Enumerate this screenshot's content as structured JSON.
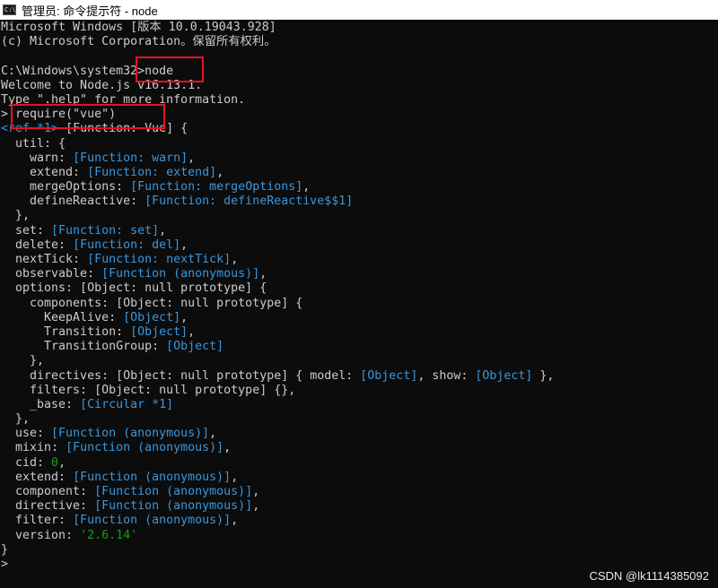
{
  "window": {
    "title": "管理员: 命令提示符 - node",
    "icon": "cmd-icon"
  },
  "console": {
    "lines": [
      [
        {
          "t": "Microsoft Windows [版本 10.0.19043.928]"
        }
      ],
      [
        {
          "t": "(c) Microsoft Corporation。保留所有权利。"
        }
      ],
      [
        {
          "t": ""
        }
      ],
      [
        {
          "t": "C:\\Windows\\system32>node"
        }
      ],
      [
        {
          "t": "Welcome to Node.js v16.13.1."
        }
      ],
      [
        {
          "t": "Type \".help\" for more information."
        }
      ],
      [
        {
          "t": "> require(\"vue\")"
        }
      ],
      [
        {
          "t": "<ref *1> ",
          "c": "fn"
        },
        {
          "t": "[Function: Vue] {"
        }
      ],
      [
        {
          "t": "  util: {"
        }
      ],
      [
        {
          "t": "    warn: "
        },
        {
          "t": "[Function: warn]",
          "c": "fn"
        },
        {
          "t": ","
        }
      ],
      [
        {
          "t": "    extend: "
        },
        {
          "t": "[Function: extend]",
          "c": "fn"
        },
        {
          "t": ","
        }
      ],
      [
        {
          "t": "    mergeOptions: "
        },
        {
          "t": "[Function: mergeOptions]",
          "c": "fn"
        },
        {
          "t": ","
        }
      ],
      [
        {
          "t": "    defineReactive: "
        },
        {
          "t": "[Function: defineReactive$$1]",
          "c": "fn"
        }
      ],
      [
        {
          "t": "  },"
        }
      ],
      [
        {
          "t": "  set: "
        },
        {
          "t": "[Function: set]",
          "c": "fn"
        },
        {
          "t": ","
        }
      ],
      [
        {
          "t": "  delete: "
        },
        {
          "t": "[Function: del]",
          "c": "fn"
        },
        {
          "t": ","
        }
      ],
      [
        {
          "t": "  nextTick: "
        },
        {
          "t": "[Function: nextTick]",
          "c": "fn"
        },
        {
          "t": ","
        }
      ],
      [
        {
          "t": "  observable: "
        },
        {
          "t": "[Function (anonymous)]",
          "c": "fn"
        },
        {
          "t": ","
        }
      ],
      [
        {
          "t": "  options: [Object: null prototype] {"
        }
      ],
      [
        {
          "t": "    components: [Object: null prototype] {"
        }
      ],
      [
        {
          "t": "      KeepAlive: "
        },
        {
          "t": "[Object]",
          "c": "fn"
        },
        {
          "t": ","
        }
      ],
      [
        {
          "t": "      Transition: "
        },
        {
          "t": "[Object]",
          "c": "fn"
        },
        {
          "t": ","
        }
      ],
      [
        {
          "t": "      TransitionGroup: "
        },
        {
          "t": "[Object]",
          "c": "fn"
        }
      ],
      [
        {
          "t": "    },"
        }
      ],
      [
        {
          "t": "    directives: [Object: null prototype] { model: "
        },
        {
          "t": "[Object]",
          "c": "fn"
        },
        {
          "t": ", show: "
        },
        {
          "t": "[Object]",
          "c": "fn"
        },
        {
          "t": " },"
        }
      ],
      [
        {
          "t": "    filters: [Object: null prototype] {},"
        }
      ],
      [
        {
          "t": "    _base: "
        },
        {
          "t": "[Circular *1]",
          "c": "fn"
        }
      ],
      [
        {
          "t": "  },"
        }
      ],
      [
        {
          "t": "  use: "
        },
        {
          "t": "[Function (anonymous)]",
          "c": "fn"
        },
        {
          "t": ","
        }
      ],
      [
        {
          "t": "  mixin: "
        },
        {
          "t": "[Function (anonymous)]",
          "c": "fn"
        },
        {
          "t": ","
        }
      ],
      [
        {
          "t": "  cid: "
        },
        {
          "t": "0",
          "c": "num"
        },
        {
          "t": ","
        }
      ],
      [
        {
          "t": "  extend: "
        },
        {
          "t": "[Function (anonymous)]",
          "c": "fn"
        },
        {
          "t": ","
        }
      ],
      [
        {
          "t": "  component: "
        },
        {
          "t": "[Function (anonymous)]",
          "c": "fn"
        },
        {
          "t": ","
        }
      ],
      [
        {
          "t": "  directive: "
        },
        {
          "t": "[Function (anonymous)]",
          "c": "fn"
        },
        {
          "t": ","
        }
      ],
      [
        {
          "t": "  filter: "
        },
        {
          "t": "[Function (anonymous)]",
          "c": "fn"
        },
        {
          "t": ","
        }
      ],
      [
        {
          "t": "  version: "
        },
        {
          "t": "'2.6.14'",
          "c": "str"
        }
      ],
      [
        {
          "t": "}"
        }
      ],
      [
        {
          "t": ">"
        }
      ]
    ]
  },
  "watermark": "CSDN @lk1114385092",
  "colors": {
    "background": "#0c0c0c",
    "text": "#cccccc",
    "function": "#3a96dd",
    "number_string": "#13a10e",
    "highlight_box": "#e81123"
  }
}
